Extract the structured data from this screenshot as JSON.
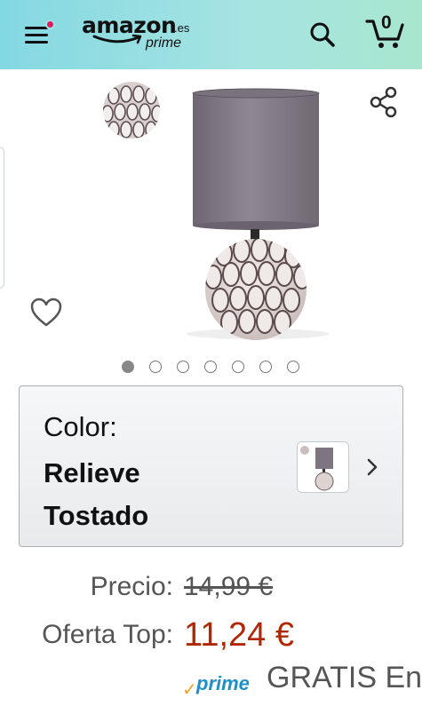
{
  "header": {
    "logo_word": "amazon",
    "logo_tld": ".es",
    "logo_sub": "prime",
    "cart_count": "0"
  },
  "gallery": {
    "total_images": 7,
    "active_index": 0
  },
  "variation": {
    "label": "Color:",
    "value": "Relieve Tostado"
  },
  "pricing": {
    "list_label": "Precio:",
    "list_price": "14,99 €",
    "deal_label": "Oferta Top:",
    "deal_price": "11,24 €"
  },
  "delivery": {
    "prime_check": "✓",
    "prime_label": "prime",
    "text": "GRATIS En"
  },
  "colors": {
    "header_start": "#84d8e3",
    "header_end": "#a8e6cf",
    "deal_price": "#b12704",
    "prime_blue": "#1f8fc9",
    "prime_check": "#f6a019",
    "notification_dot": "#e3195b"
  }
}
